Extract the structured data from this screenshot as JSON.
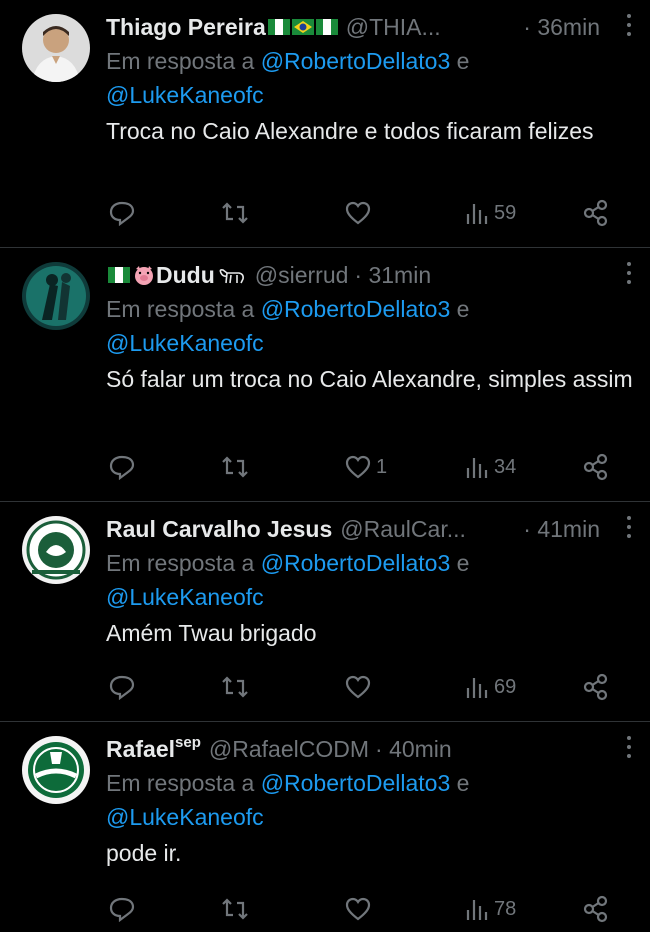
{
  "reply_prefix": "Em resposta a",
  "reply_joiner": "e",
  "tweets": [
    {
      "name": "Thiago Pereira",
      "handle": "@THIA...",
      "time": "· 36min",
      "mention1": "@RobertoDellato3",
      "mention2": "@LukeKaneofc",
      "text": "Troca no Caio Alexandre e todos ficaram felizes",
      "likes": "",
      "views": "59"
    },
    {
      "name": "Dudu",
      "handle": "@sierrud",
      "time": "· 31min",
      "mention1": "@RobertoDellato3",
      "mention2": "@LukeKaneofc",
      "text": "Só falar um troca no Caio Alexandre, simples assim",
      "likes": "1",
      "views": "34"
    },
    {
      "name": "Raul Carvalho Jesus",
      "handle": "@RaulCar...",
      "time": "· 41min",
      "mention1": "@RobertoDellato3",
      "mention2": "@LukeKaneofc",
      "text": "Amém Twau brigado",
      "likes": "",
      "views": "69"
    },
    {
      "name": "Rafael",
      "name_sup": "sep",
      "handle": "@RafaelCODM",
      "time": "· 40min",
      "mention1": "@RobertoDellato3",
      "mention2": "@LukeKaneofc",
      "text": "pode ir.",
      "likes": "",
      "views": "78"
    }
  ],
  "colors": {
    "background": "#000000",
    "text": "#e7e9ea",
    "muted": "#71767b",
    "link": "#1d9bf0",
    "divider": "#2f3336"
  },
  "icons": [
    "reply-icon",
    "retweet-icon",
    "like-icon",
    "views-icon",
    "share-icon",
    "more-icon"
  ]
}
